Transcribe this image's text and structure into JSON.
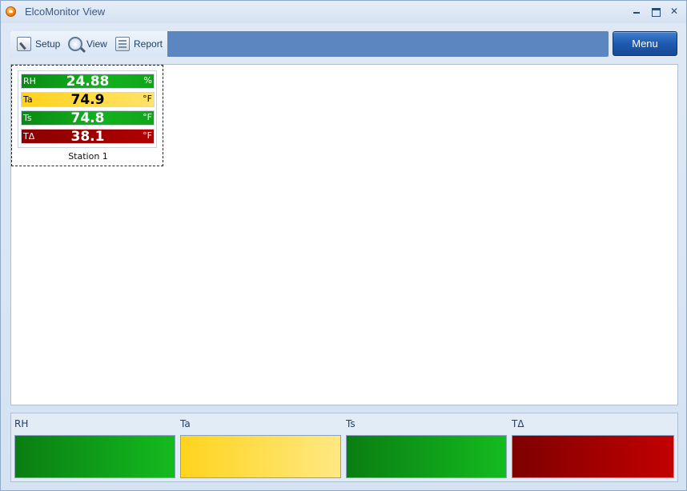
{
  "window": {
    "title": "ElcoMonitor View"
  },
  "ribbon": {
    "items": [
      {
        "label": "Setup",
        "icon": "setup-icon"
      },
      {
        "label": "View",
        "icon": "magnifier-icon"
      },
      {
        "label": "Report",
        "icon": "report-icon"
      }
    ],
    "menu_label": "Menu"
  },
  "station": {
    "name": "Station 1",
    "metrics": [
      {
        "label": "RH",
        "value": "24.88",
        "unit": "%",
        "status_color": "#12ad1c"
      },
      {
        "label": "Ta",
        "value": "74.9",
        "unit": "°F",
        "status_color": "#ffd92e"
      },
      {
        "label": "Ts",
        "value": "74.8",
        "unit": "°F",
        "status_color": "#12ad1c"
      },
      {
        "label": "TΔ",
        "value": "38.1",
        "unit": "°F",
        "status_color": "#a00000"
      }
    ]
  },
  "legend": {
    "items": [
      {
        "label": "RH",
        "color": "#12ad1c"
      },
      {
        "label": "Ta",
        "color": "#ffd92e"
      },
      {
        "label": "Ts",
        "color": "#12ad1c"
      },
      {
        "label": "TΔ",
        "color": "#a00000"
      }
    ]
  }
}
